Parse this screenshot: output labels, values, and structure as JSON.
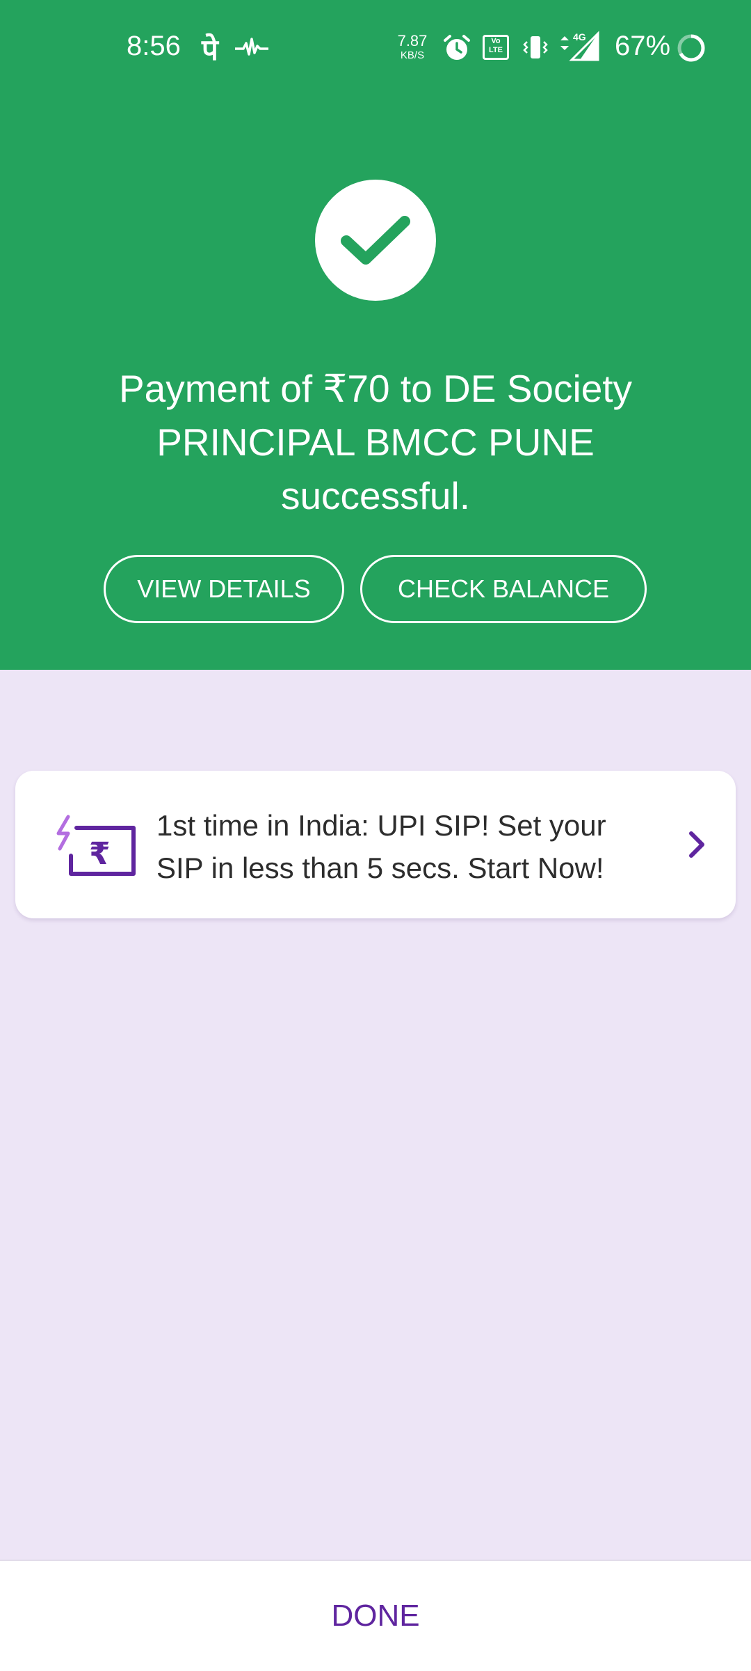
{
  "status_bar": {
    "time": "8:56",
    "app_glyph": "पे",
    "network_speed_value": "7.87",
    "network_speed_unit": "KB/S",
    "volte_label": "Vo LTE",
    "network_type": "4G",
    "battery_percent": "67%",
    "icons": [
      "phonepe-icon",
      "pulse-icon",
      "alarm-icon",
      "volte-icon",
      "vibrate-icon",
      "signal-icon",
      "battery-icon"
    ]
  },
  "success": {
    "message": "Payment of ₹70 to DE Society PRINCIPAL BMCC PUNE successful.",
    "view_details_label": "VIEW DETAILS",
    "check_balance_label": "CHECK BALANCE"
  },
  "promo": {
    "text": "1st time in India: UPI SIP! Set your SIP in less than 5 secs. Start Now!",
    "icon": "sip-rupee-icon"
  },
  "footer": {
    "done_label": "DONE"
  },
  "colors": {
    "success_green": "#24a35d",
    "page_background": "#ede5f6",
    "brand_purple": "#5f259f",
    "accent_lilac": "#b36ee0"
  }
}
